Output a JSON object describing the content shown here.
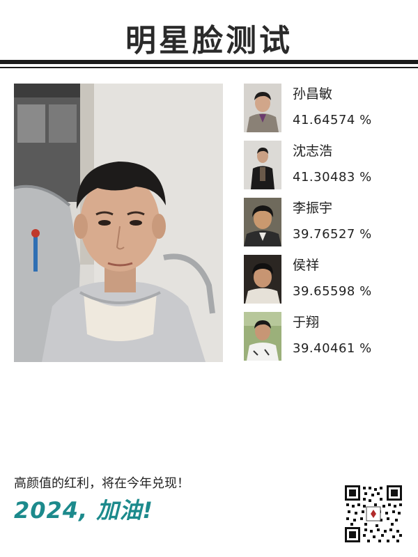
{
  "header": {
    "title": "明星脸测试"
  },
  "matches": [
    {
      "name": "孙昌敏",
      "percent": "41.64574 %",
      "thumb_icon": "celebrity-photo-1"
    },
    {
      "name": "沈志浩",
      "percent": "41.30483 %",
      "thumb_icon": "celebrity-photo-2"
    },
    {
      "name": "李振宇",
      "percent": "39.76527 %",
      "thumb_icon": "celebrity-photo-3"
    },
    {
      "name": "侯祥",
      "percent": "39.65598 %",
      "thumb_icon": "celebrity-photo-4"
    },
    {
      "name": "于翔",
      "percent": "39.40461 %",
      "thumb_icon": "celebrity-photo-5"
    }
  ],
  "footer": {
    "caption": "高颜值的红利，将在今年兑现！",
    "slogan": "2024, 加油!"
  },
  "colors": {
    "slogan": "#1c8a8c",
    "rule": "#1a1a1a",
    "text": "#222222"
  }
}
